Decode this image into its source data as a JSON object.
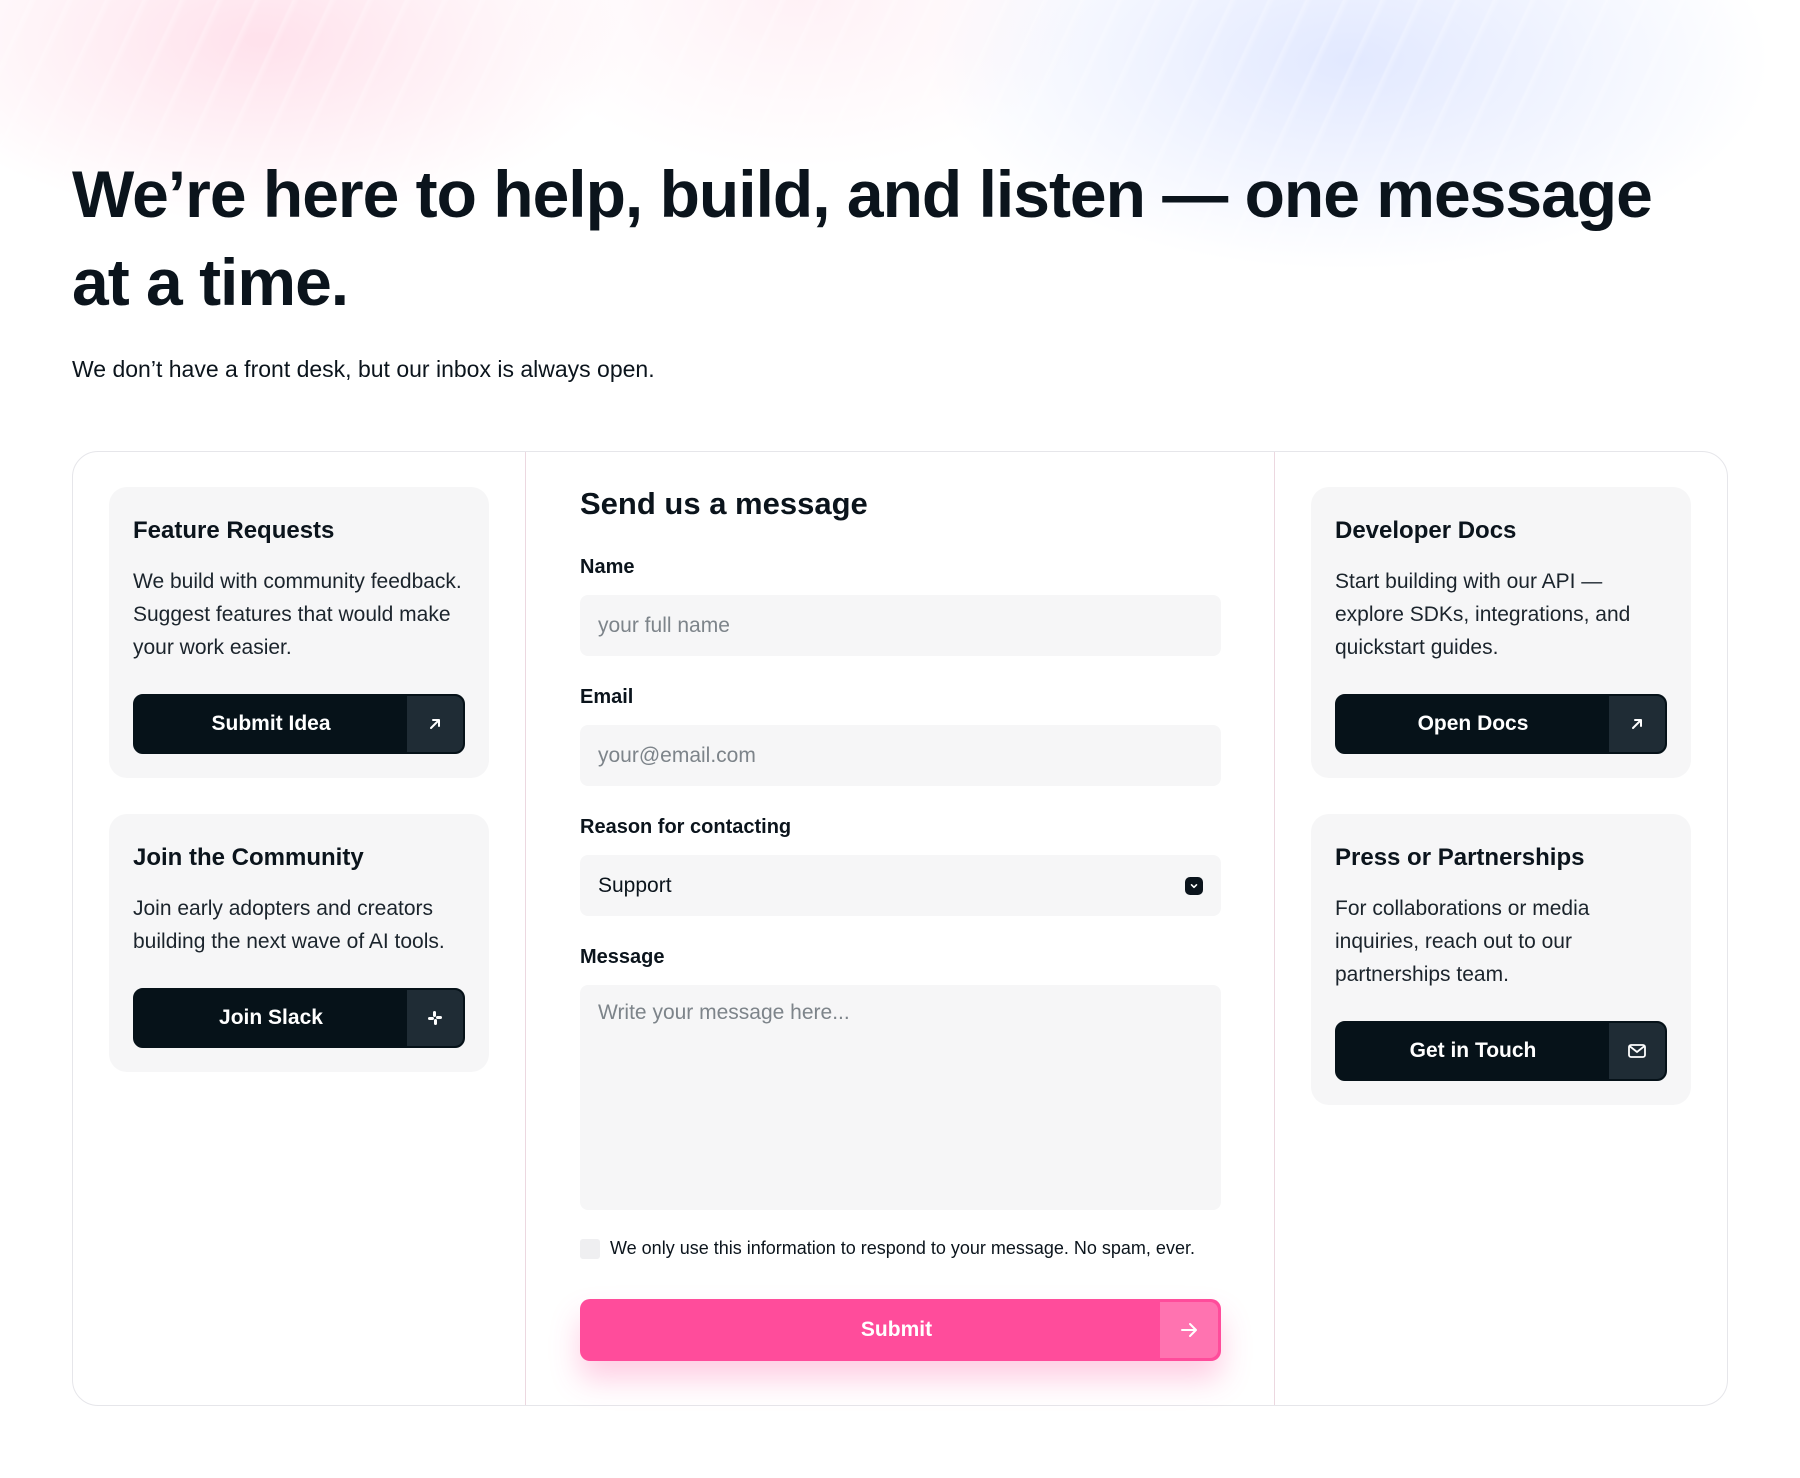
{
  "hero": {
    "title": "We’re here to help, build, and listen — one message at a time.",
    "subtitle": "We don’t have a front desk, but our inbox is always open."
  },
  "left_cards": [
    {
      "title": "Feature Requests",
      "text": "We build with community feedback. Suggest features that would make your work easier.",
      "button": "Submit Idea",
      "icon": "arrow-up-right-icon"
    },
    {
      "title": "Join the Community",
      "text": "Join early adopters and creators building the next wave of AI tools.",
      "button": "Join Slack",
      "icon": "slack-icon"
    }
  ],
  "form": {
    "title": "Send us a message",
    "name_label": "Name",
    "name_placeholder": "your full name",
    "email_label": "Email",
    "email_placeholder": "your@email.com",
    "reason_label": "Reason for contacting",
    "reason_value": "Support",
    "message_label": "Message",
    "message_placeholder": "Write your message here...",
    "consent_text": "We only use this information to respond to your message. No spam, ever.",
    "submit_label": "Submit"
  },
  "right_cards": [
    {
      "title": "Developer Docs",
      "text": "Start building with our API — explore SDKs, integrations, and quickstart guides.",
      "button": "Open Docs",
      "icon": "arrow-up-right-icon"
    },
    {
      "title": "Press or Partnerships",
      "text": "For collaborations or media inquiries, reach out to our partnerships team.",
      "button": "Get in Touch",
      "icon": "mail-icon"
    }
  ],
  "colors": {
    "accent": "#ff4c9b",
    "dark_button": "#061219",
    "card_bg": "#f6f6f7"
  }
}
